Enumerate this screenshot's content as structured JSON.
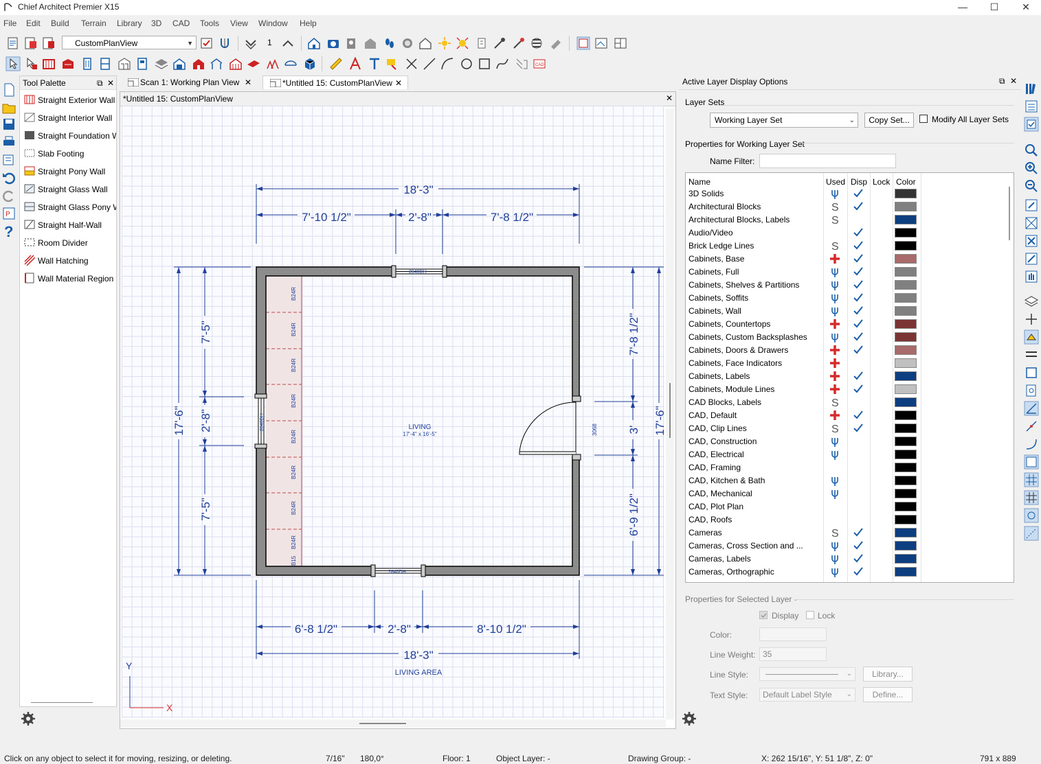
{
  "app": {
    "title": "Chief Architect Premier X15"
  },
  "menu": [
    "File",
    "Edit",
    "Build",
    "Terrain",
    "Library",
    "3D",
    "CAD",
    "Tools",
    "View",
    "Window",
    "Help"
  ],
  "toolbar": {
    "view_combo": "CustomPlanView",
    "floor_number": "1"
  },
  "tool_palette": {
    "title": "Tool Palette",
    "items": [
      "Straight Exterior Wall",
      "Straight Interior Wall",
      "Straight Foundation W",
      "Slab Footing",
      "Straight Pony Wall",
      "Straight Glass Wall",
      "Straight Glass Pony W",
      "Straight Half-Wall",
      "Room Divider",
      "Wall Hatching",
      "Wall Material Region"
    ]
  },
  "tabs": [
    {
      "label": "Scan 1:  Working Plan View"
    },
    {
      "label": "*Untitled 15: CustomPlanView"
    }
  ],
  "plan": {
    "header": "*Untitled 15: CustomPlanView",
    "dims": {
      "top_total": "18'-3\"",
      "top_a": "7'-10 1/2\"",
      "top_b": "2'-8\"",
      "top_c": "7'-8 1/2\"",
      "bottom_total": "18'-3\"",
      "bottom_a": "6'-8 1/2\"",
      "bottom_b": "2'-8\"",
      "bottom_c": "8'-10 1/2\"",
      "left_total": "17'-6\"",
      "left_a": "7'-5\"",
      "left_b": "2'-8\"",
      "left_c": "7'-5\"",
      "right_total": "17'-6\"",
      "right_a": "7'-8 1/2\"",
      "right_b": "3'",
      "right_c": "6'-9 1/2\""
    },
    "window_label": "2840DH",
    "door_label": "3068",
    "cabinet_label": "B24R",
    "cabinet_partial": "B15",
    "room_name": "LIVING",
    "room_size": "17'-4\" x 16'-5\"",
    "area_label": "LIVING AREA",
    "axis_x": "X",
    "axis_y": "Y"
  },
  "layer_panel": {
    "title": "Active Layer Display Options",
    "layer_sets_label": "Layer Sets",
    "layer_set_value": "Working Layer Set",
    "copy_set_label": "Copy Set...",
    "modify_all_label": "Modify All Layer Sets",
    "properties_for_label": "Properties for  Working Layer Set",
    "name_filter_label": "Name Filter:",
    "columns": {
      "name": "Name",
      "used": "Used",
      "disp": "Disp",
      "lock": "Lock",
      "color": "Color"
    },
    "layers": [
      {
        "name": "3D Solids",
        "used": "dot",
        "disp": true,
        "color": "#333333"
      },
      {
        "name": "Architectural Blocks",
        "used": "S",
        "disp": true,
        "color": "#808080"
      },
      {
        "name": "Architectural Blocks, Labels",
        "used": "S",
        "disp": false,
        "color": "#0c3e80"
      },
      {
        "name": "Audio/Video",
        "used": "",
        "disp": true,
        "color": "#000000"
      },
      {
        "name": "Brick Ledge Lines",
        "used": "S",
        "disp": true,
        "color": "#000000"
      },
      {
        "name": "Cabinets,  Base",
        "used": "plus",
        "disp": true,
        "color": "#a86a6a"
      },
      {
        "name": "Cabinets,  Full",
        "used": "dot",
        "disp": true,
        "color": "#808080"
      },
      {
        "name": "Cabinets,  Shelves & Partitions",
        "used": "dot",
        "disp": true,
        "color": "#808080"
      },
      {
        "name": "Cabinets,  Soffits",
        "used": "dot",
        "disp": true,
        "color": "#808080"
      },
      {
        "name": "Cabinets,  Wall",
        "used": "dot",
        "disp": true,
        "color": "#808080"
      },
      {
        "name": "Cabinets, Countertops",
        "used": "plus",
        "disp": true,
        "color": "#7a3434"
      },
      {
        "name": "Cabinets, Custom Backsplashes",
        "used": "dot",
        "disp": true,
        "color": "#7a3434"
      },
      {
        "name": "Cabinets, Doors & Drawers",
        "used": "plus",
        "disp": true,
        "color": "#a86a6a"
      },
      {
        "name": "Cabinets, Face Indicators",
        "used": "plus",
        "disp": false,
        "color": "#c0c0c0"
      },
      {
        "name": "Cabinets, Labels",
        "used": "plus",
        "disp": true,
        "color": "#0c3e80"
      },
      {
        "name": "Cabinets, Module Lines",
        "used": "plus",
        "disp": true,
        "color": "#c0c0c0"
      },
      {
        "name": "CAD Blocks, Labels",
        "used": "S",
        "disp": false,
        "color": "#0c3e80"
      },
      {
        "name": "CAD,  Default",
        "used": "plus",
        "disp": true,
        "color": "#000000"
      },
      {
        "name": "CAD, Clip Lines",
        "used": "S",
        "disp": true,
        "color": "#000000"
      },
      {
        "name": "CAD, Construction",
        "used": "dot",
        "disp": false,
        "color": "#000000"
      },
      {
        "name": "CAD, Electrical",
        "used": "dot",
        "disp": false,
        "color": "#000000"
      },
      {
        "name": "CAD, Framing",
        "used": "",
        "disp": false,
        "color": "#000000"
      },
      {
        "name": "CAD, Kitchen & Bath",
        "used": "dot",
        "disp": false,
        "color": "#000000"
      },
      {
        "name": "CAD, Mechanical",
        "used": "dot",
        "disp": false,
        "color": "#000000"
      },
      {
        "name": "CAD, Plot Plan",
        "used": "",
        "disp": false,
        "color": "#000000"
      },
      {
        "name": "CAD, Roofs",
        "used": "",
        "disp": false,
        "color": "#000000"
      },
      {
        "name": "Cameras",
        "used": "S",
        "disp": true,
        "color": "#0c3e80"
      },
      {
        "name": "Cameras, Cross Section and ...",
        "used": "dot",
        "disp": true,
        "color": "#0c3e80"
      },
      {
        "name": "Cameras, Labels",
        "used": "dot",
        "disp": true,
        "color": "#0c3e80"
      },
      {
        "name": "Cameras, Orthographic",
        "used": "dot",
        "disp": true,
        "color": "#0c3e80"
      }
    ],
    "selected": {
      "title": "Properties for Selected Layer -",
      "display_label": "Display",
      "lock_label": "Lock",
      "color_label": "Color:",
      "line_weight_label": "Line Weight:",
      "line_weight_value": "35",
      "line_style_label": "Line Style:",
      "library_label": "Library...",
      "text_style_label": "Text Style:",
      "text_style_value": "Default Label Style",
      "define_label": "Define..."
    }
  },
  "status": {
    "message": "Click on any object to select it for moving, resizing, or deleting.",
    "snap": "7/16\"",
    "angle": "180,0°",
    "floor": "Floor: 1",
    "object_layer": "Object Layer: -",
    "drawing_group": "Drawing Group: -",
    "coords": "X: 262 15/16\", Y: 51 1/8\", Z: 0\"",
    "size": "791 x 889"
  },
  "colors": {
    "dim_blue": "#1f3f9a",
    "wall_grey": "#8c8c8c",
    "check_blue": "#1a5fa8",
    "plus_red": "#d62b2b"
  }
}
